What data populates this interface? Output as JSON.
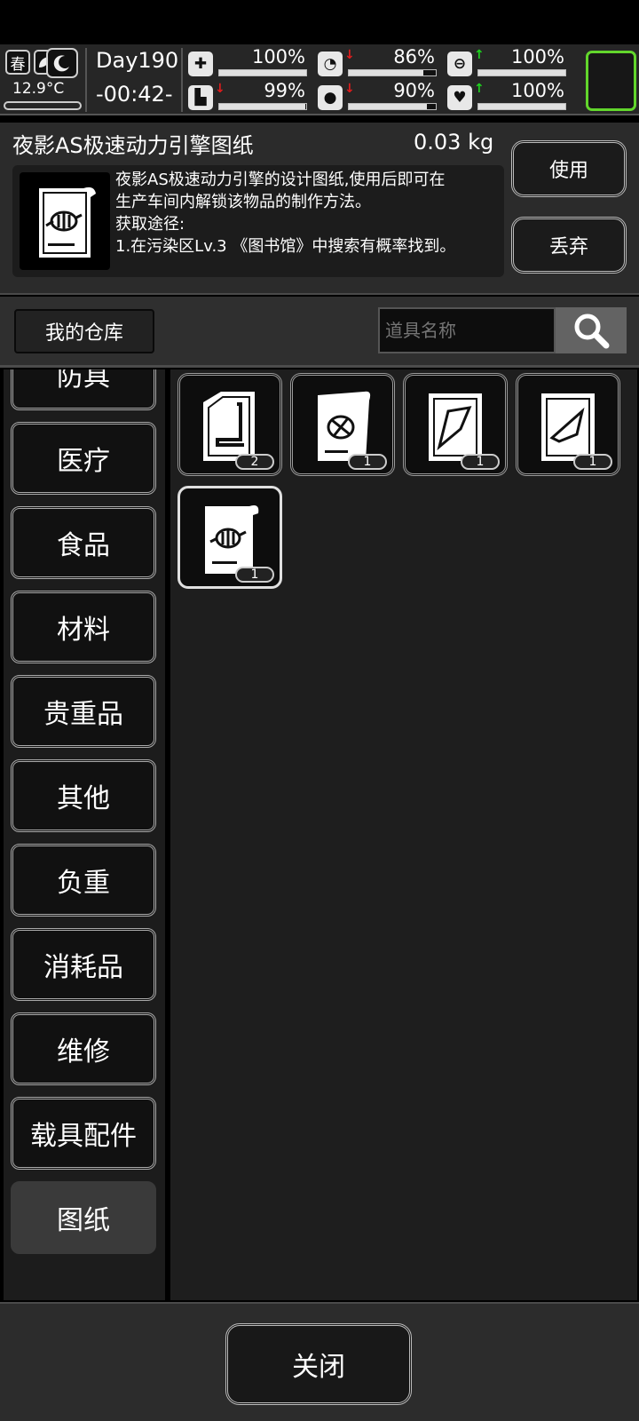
{
  "status": {
    "season": "春",
    "temperature": "12.9°C",
    "day": "Day190",
    "time": "-00:42-",
    "stats": [
      {
        "icon": "medkit-icon",
        "value": "100%",
        "level": 1.0,
        "trend": ""
      },
      {
        "icon": "stomach-icon",
        "value": "86%",
        "level": 0.86,
        "trend": "down"
      },
      {
        "icon": "energy-capsule-icon",
        "value": "100%",
        "level": 1.0,
        "trend": "up"
      },
      {
        "icon": "boot-icon",
        "value": "99%",
        "level": 0.99,
        "trend": "down"
      },
      {
        "icon": "water-drop-icon",
        "value": "90%",
        "level": 0.9,
        "trend": "down"
      },
      {
        "icon": "heart-icon",
        "value": "100%",
        "level": 1.0,
        "trend": "up"
      }
    ]
  },
  "detail": {
    "name": "夜影AS极速动力引擎图纸",
    "weight": "0.03 kg",
    "description": "夜影AS极速动力引擎的设计图纸,使用后即可在\n生产车间内解锁该物品的制作方法。\n获取途径:\n1.在污染区Lv.3 《图书馆》中搜索有概率找到。",
    "use_label": "使用",
    "discard_label": "丢弃"
  },
  "warehouse": {
    "label": "我的仓库",
    "search_placeholder": "道具名称"
  },
  "categories": [
    "防具",
    "医疗",
    "食品",
    "材料",
    "贵重品",
    "其他",
    "负重",
    "消耗品",
    "维修",
    "载具配件",
    "图纸"
  ],
  "active_category": "图纸",
  "items": [
    {
      "icon": "seat-blueprint-icon",
      "count": "2"
    },
    {
      "icon": "turbine-blueprint-icon",
      "count": "1"
    },
    {
      "icon": "frame-blueprint-icon",
      "count": "1"
    },
    {
      "icon": "wing-blueprint-icon",
      "count": "1"
    },
    {
      "icon": "engine-blueprint-icon",
      "count": "1"
    }
  ],
  "close_label": "关闭"
}
